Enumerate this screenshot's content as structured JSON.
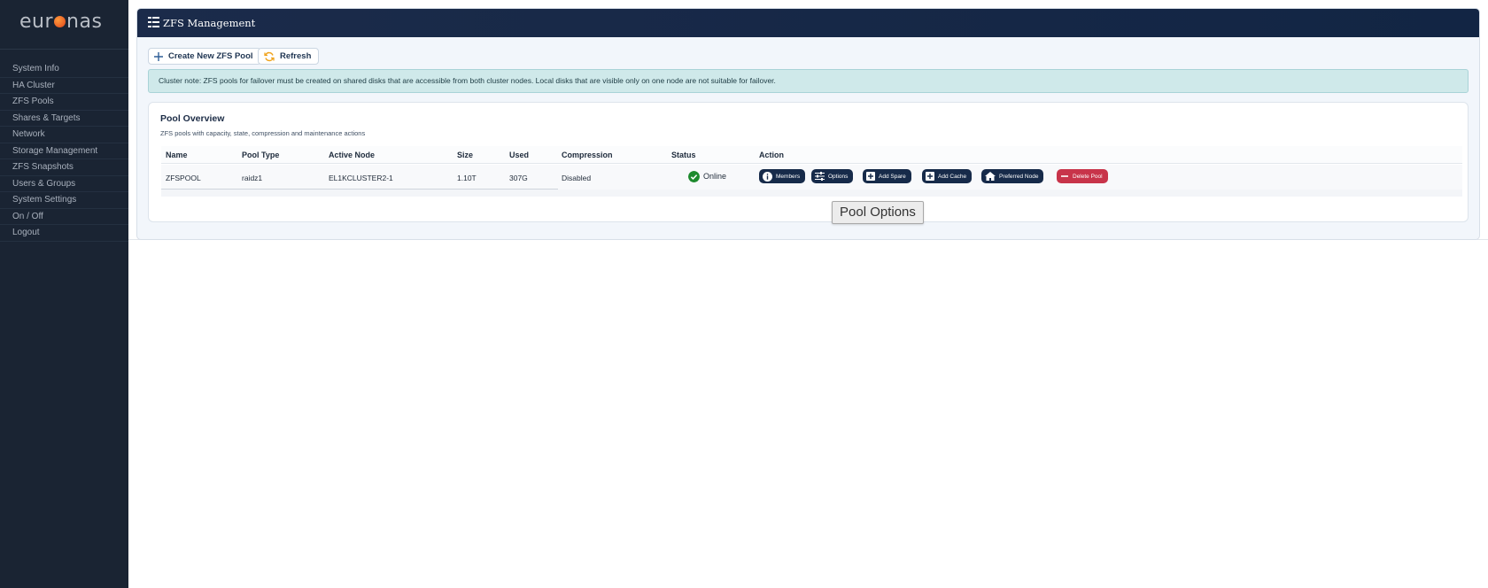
{
  "logo": {
    "left": "eur",
    "right": "nas"
  },
  "sidebar": {
    "items": [
      {
        "label": "System Info"
      },
      {
        "label": "HA Cluster"
      },
      {
        "label": "ZFS Pools"
      },
      {
        "label": "Shares & Targets"
      },
      {
        "label": "Network"
      },
      {
        "label": "Storage Management"
      },
      {
        "label": "ZFS Snapshots"
      },
      {
        "label": "Users & Groups"
      },
      {
        "label": "System Settings"
      },
      {
        "label": "On / Off"
      },
      {
        "label": "Logout"
      }
    ]
  },
  "header": {
    "title": "ZFS  Management"
  },
  "toolbar": {
    "create_label": "Create New ZFS Pool",
    "refresh_label": "Refresh"
  },
  "alert": {
    "text": "Cluster note: ZFS pools for failover must be created on shared disks that are accessible from both cluster nodes. Local disks that are visible only on one node are not suitable for failover."
  },
  "pool_overview": {
    "title": "Pool Overview",
    "subtitle": "ZFS pools with capacity, state, compression and maintenance actions",
    "columns": [
      "Name",
      "Pool Type",
      "Active Node",
      "Size",
      "Used",
      "Compression",
      "Status",
      "Action"
    ],
    "rows": [
      {
        "name": "ZFSPOOL",
        "pool_type": "raidz1",
        "active_node": "EL1KCLUSTER2-1",
        "size": "1.10T",
        "used": "307G",
        "compression": "Disabled",
        "status": "Online"
      }
    ],
    "actions": {
      "members": "Members",
      "options": "Options",
      "add_spare": "Add Spare",
      "add_cache": "Add Cache",
      "preferred_node": "Preferred Node",
      "delete_pool": "Delete Pool"
    }
  },
  "tooltip": {
    "text": "Pool Options"
  },
  "colors": {
    "sidebar_bg": "#1a2433",
    "header_bg": "#1b2b4a",
    "action_button": "#172b4a",
    "danger_button": "#c8344a",
    "status_ok": "#1e8a2e",
    "alert_bg": "#cfe9ea"
  },
  "icons": {
    "create": "plus-icon",
    "refresh": "refresh-icon",
    "header": "zfs-stack-icon",
    "status": "check-circle-icon",
    "members": "info-icon",
    "options": "sliders-icon",
    "add_spare": "plus-square-icon",
    "add_cache": "plus-square-icon",
    "preferred_node": "home-icon",
    "delete_pool": "minus-icon"
  }
}
